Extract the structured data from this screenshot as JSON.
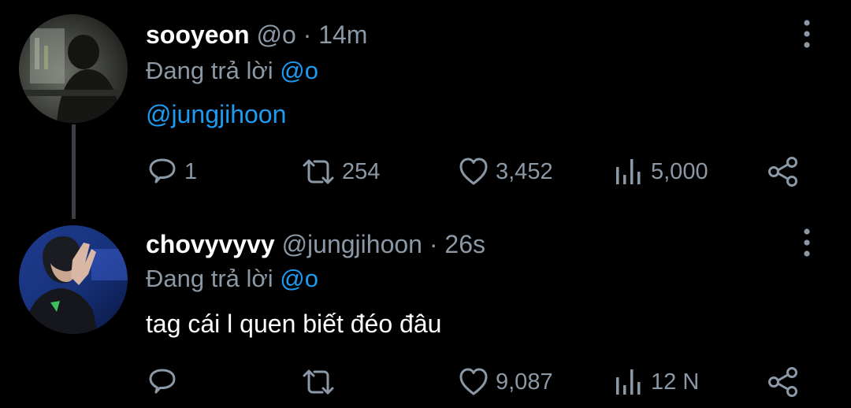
{
  "tweets": [
    {
      "name": "sooyeon",
      "handle": "@o",
      "time": "14m",
      "reply_prefix": "Đang trả lời",
      "reply_mention": "@o",
      "text": "@jungjihoon",
      "replies": "1",
      "retweets": "254",
      "likes": "3,452",
      "views": "5,000"
    },
    {
      "name": "chovyvyvy",
      "handle": "@jungjihoon",
      "time": "26s",
      "reply_prefix": "Đang trả lời",
      "reply_mention": "@o",
      "text": "tag cái l quen biết đéo đâu",
      "replies": "",
      "retweets": "",
      "likes": "9,087",
      "views": "12 N"
    }
  ],
  "icons": [
    "reply-icon",
    "retweet-icon",
    "like-icon",
    "views-icon",
    "share-icon",
    "more-options-icon"
  ],
  "colors": {
    "background": "#000000",
    "name": "#ffffff",
    "secondary": "#8b98a5",
    "link": "#1d9bf0",
    "thread_line": "#3a3d41"
  }
}
